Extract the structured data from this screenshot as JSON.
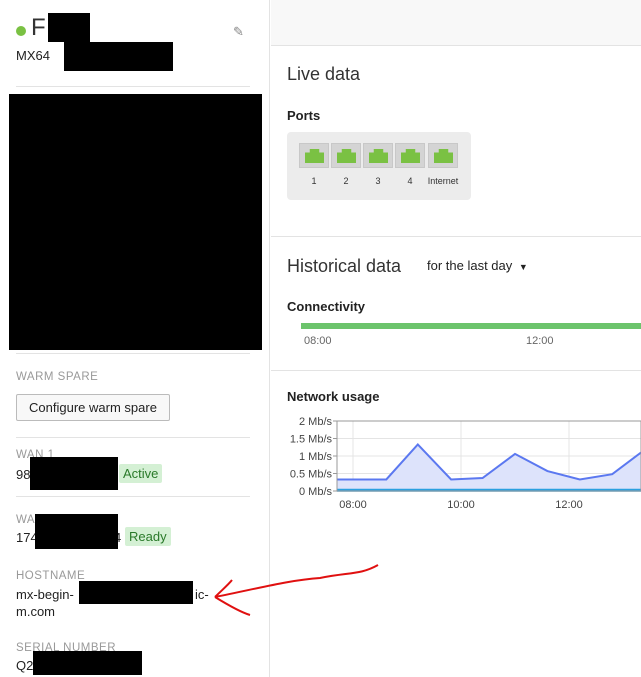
{
  "device": {
    "name_visible": "F",
    "model": "MX64",
    "status_color": "#7ac143",
    "edit_icon": "pencil-icon"
  },
  "warm_spare": {
    "label": "WARM SPARE",
    "button": "Configure warm spare"
  },
  "wan1": {
    "label": "WAN 1",
    "value_visible": "98",
    "status": "Active"
  },
  "wan2": {
    "label_visible": "WA",
    "value_visible": "174",
    "value_suffix_visible": "4",
    "status": "Ready"
  },
  "hostname": {
    "label": "HOSTNAME",
    "line1_start": "mx-begin-",
    "line1_end": "ic-",
    "line2": "m.com"
  },
  "serial": {
    "label": "SERIAL NUMBER",
    "value_visible": "Q2"
  },
  "live": {
    "title": "Live data",
    "ports_title": "Ports",
    "ports": [
      {
        "label": "1",
        "status": "connected"
      },
      {
        "label": "2",
        "status": "connected"
      },
      {
        "label": "3",
        "status": "connected"
      },
      {
        "label": "4",
        "status": "connected"
      },
      {
        "label": "Internet",
        "status": "connected"
      }
    ],
    "port_color": "#7ac143"
  },
  "historical": {
    "title": "Historical data",
    "range": "for the last day",
    "connectivity_title": "Connectivity",
    "connectivity_ticks": [
      "08:00",
      "12:00"
    ],
    "connectivity_color": "#6cc46c",
    "usage_title": "Network usage"
  },
  "chart_data": {
    "type": "area",
    "y_ticks": [
      "2 Mb/s",
      "1.5 Mb/s",
      "1 Mb/s",
      "0.5 Mb/s",
      "0 Mb/s"
    ],
    "x_ticks": [
      "08:00",
      "10:00",
      "12:00"
    ],
    "ylim": [
      0,
      2
    ],
    "grid": true,
    "series": [
      {
        "color": "#5b78f0",
        "x": [
          "07:42",
          "08:37",
          "09:12",
          "09:49",
          "10:24",
          "11:00",
          "11:36",
          "12:12",
          "12:48",
          "13:20"
        ],
        "values": [
          0.33,
          0.33,
          1.33,
          0.33,
          0.37,
          1.06,
          0.57,
          0.33,
          0.48,
          1.1
        ]
      },
      {
        "color": "#2aa0e0",
        "x": [
          "07:42",
          "13:20"
        ],
        "values": [
          0.02,
          0.02
        ]
      }
    ]
  }
}
